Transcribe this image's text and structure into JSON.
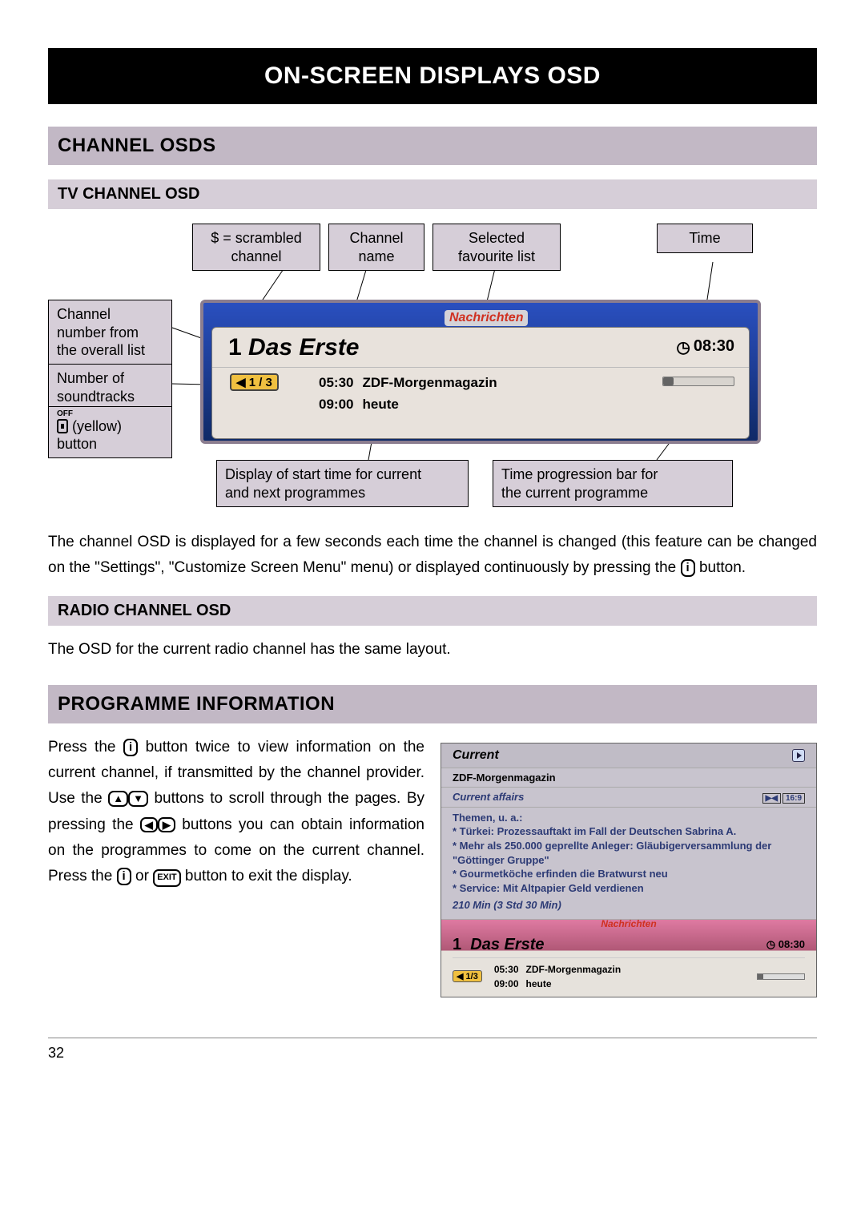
{
  "title": "ON-SCREEN DISPLAYS OSD",
  "sections": {
    "channel_osds": "CHANNEL OSDS",
    "tv_channel_osd": "TV CHANNEL OSD",
    "radio_channel_osd": "RADIO CHANNEL OSD",
    "programme_info": "PROGRAMME INFORMATION"
  },
  "labels": {
    "scrambled": "$ = scrambled\nchannel",
    "channel_name": "Channel\nname",
    "fav_list": "Selected\nfavourite list",
    "time": "Time",
    "channel_number": "Channel\nnumber from\nthe overall list",
    "soundtracks": "Number of\nsoundtracks",
    "yellow_button": "(yellow)\nbutton",
    "start_time": "Display of start time for current\nand next programmes",
    "progress": "Time progression bar for\nthe current programme"
  },
  "osd": {
    "tag": "Nachrichten",
    "channel_num": "1",
    "channel_name": "Das Erste",
    "time": "08:30",
    "sound_badge": "◀  1 / 3",
    "programmes": [
      {
        "time": "05:30",
        "title": "ZDF-Morgenmagazin"
      },
      {
        "time": "09:00",
        "title": "heute"
      }
    ]
  },
  "off_label": "OFF",
  "paragraphs": {
    "p1_a": "The channel OSD is displayed for a few seconds each time the channel is changed (this feature can be changed on the \"Settings\", \"Customize Screen Menu\" menu) or displayed continuously by pressing the ",
    "p1_b": " button.",
    "radio": "The OSD for the current radio channel has the same layout.",
    "p2_a": "Press the ",
    "p2_b": " button twice to view information on the current channel, if transmitted by the channel provider. Use the ",
    "p2_c": " buttons to scroll through the pages. By pressing the ",
    "p2_d": " buttons you can obtain information on the programmes to come on the current channel. Press the ",
    "p2_e": " or ",
    "p2_f": " button to exit the display."
  },
  "prog_info": {
    "header": "Current",
    "title": "ZDF-Morgenmagazin",
    "genre": "Current affairs",
    "badges": [
      "▶◀",
      "16:9"
    ],
    "lead": "Themen, u. a.:",
    "bullets": [
      "Türkei: Prozessauftakt im Fall der Deutschen Sabrina A.",
      "Mehr als 250.000 geprellte Anleger: Gläubigerversammlung der \"Göttinger Gruppe\"",
      "Gourmetköche erfinden die Bratwurst neu",
      "Service: Mit Altpapier Geld verdienen"
    ],
    "duration": "210 Min (3 Std 30 Min)",
    "footer_tag": "Nachrichten",
    "footer_channel_num": "1",
    "footer_channel_name": "Das Erste",
    "footer_time": "08:30",
    "footer_sound": "◀ 1/3",
    "footer_programmes": [
      {
        "time": "05:30",
        "title": "ZDF-Morgenmagazin"
      },
      {
        "time": "09:00",
        "title": "heute"
      }
    ]
  },
  "icons": {
    "info": "i",
    "up": "▲",
    "down": "▼",
    "left": "◀",
    "right": "▶",
    "exit": "EXIT",
    "clock": "◷"
  },
  "page_number": "32"
}
